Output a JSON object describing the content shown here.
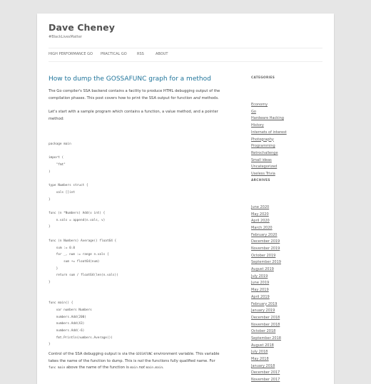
{
  "site": {
    "title": "Dave Cheney",
    "description": "#BlackLivesMatter"
  },
  "nav": {
    "items": [
      {
        "label": "HIGH PERFORMANCE GO"
      },
      {
        "label": "PRACTICAL GO"
      },
      {
        "label": "RSS"
      },
      {
        "label": "ABOUT"
      }
    ]
  },
  "post": {
    "title": "How to dump the GOSSAFUNC graph for a method",
    "intro_line1": "The Go compiler's SSA backend contains a facility to produce HTML debugging output of the",
    "intro_line2_a": "compilation phases. This post covers how to print the SSA output for function ",
    "intro_line2_em": "and",
    "intro_line2_b": " methods.",
    "sample_line1": "Let's start with a sample program which contains a function, a value method, and a pointer",
    "sample_line2": "method:",
    "code": [
      "package main",
      "",
      "import (",
      "    \"fmt\"",
      ")",
      "",
      "type Numbers struct {",
      "    vals []int",
      "}",
      "",
      "func (n *Numbers) Add(v int) {",
      "    n.vals = append(n.vals, v)",
      "}",
      "",
      "func (n Numbers) Average() float64 {",
      "    sum := 0.0",
      "    for _, num := range n.vals {",
      "        sum += float64(num)",
      "    }",
      "    return sum / float64(len(n.vals))",
      "}",
      "",
      "",
      "func main() {",
      "    var numbers Numbers",
      "    numbers.Add(200)",
      "    numbers.Add(43)",
      "    numbers.Add(-6)",
      "    fmt.Println(numbers.Average())",
      "}"
    ],
    "control_line1_a": "Control of the SSA debugging output is via the ",
    "control_line1_code": "GOSSAFUNC",
    "control_line1_b": " environment variable. This variable",
    "control_line2_a": "takes the name of the function to dump. This is ",
    "control_line2_em": "not",
    "control_line2_b": " the functions fully qualified name. For",
    "control_line3_code1": "func main",
    "control_line3_a": " above the name of the function is ",
    "control_line3_code2": "main",
    "control_line3_em": " not ",
    "control_line3_code3": "main.main",
    "control_line3_b": "."
  },
  "sidebar": {
    "categories_title": "CATEGORIES",
    "categories": [
      "Economy",
      "Go",
      "Hardware Hacking",
      "History",
      "Internets of interest",
      "Photography",
      "Programming",
      "Retrochallenge",
      "Small ideas",
      "Uncategorized",
      "Useless Trivia"
    ],
    "archives_title": "ARCHIVES",
    "archives": [
      "June 2020",
      "May 2020",
      "April 2020",
      "March 2020",
      "February 2020",
      "December 2019",
      "November 2019",
      "October 2019",
      "September 2019",
      "August 2019",
      "July 2019",
      "June 2019",
      "May 2019",
      "April 2019",
      "February 2019",
      "January 2019",
      "December 2018",
      "November 2018",
      "October 2018",
      "September 2018",
      "August 2018",
      "July 2018",
      "May 2018",
      "January 2018",
      "December 2017",
      "November 2017"
    ]
  },
  "colors": {
    "link": "#21759b",
    "background": "#e6e6e6"
  }
}
